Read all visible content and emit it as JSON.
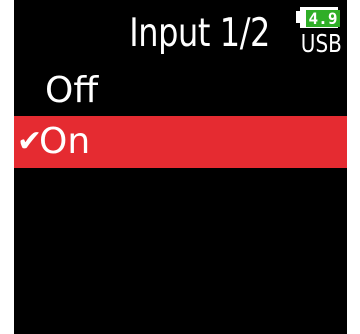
{
  "header": {
    "title": "Input 1/2",
    "battery": {
      "level_text": "4.9",
      "source": "USB",
      "level_color": "#2fae27"
    }
  },
  "menu": {
    "options": [
      {
        "label": "Off",
        "checked": false,
        "selected": false
      },
      {
        "label": "On",
        "checked": true,
        "selected": true,
        "check_icon": "check-icon",
        "check_glyph": "✔"
      }
    ],
    "selected_color": "#e52b31"
  }
}
